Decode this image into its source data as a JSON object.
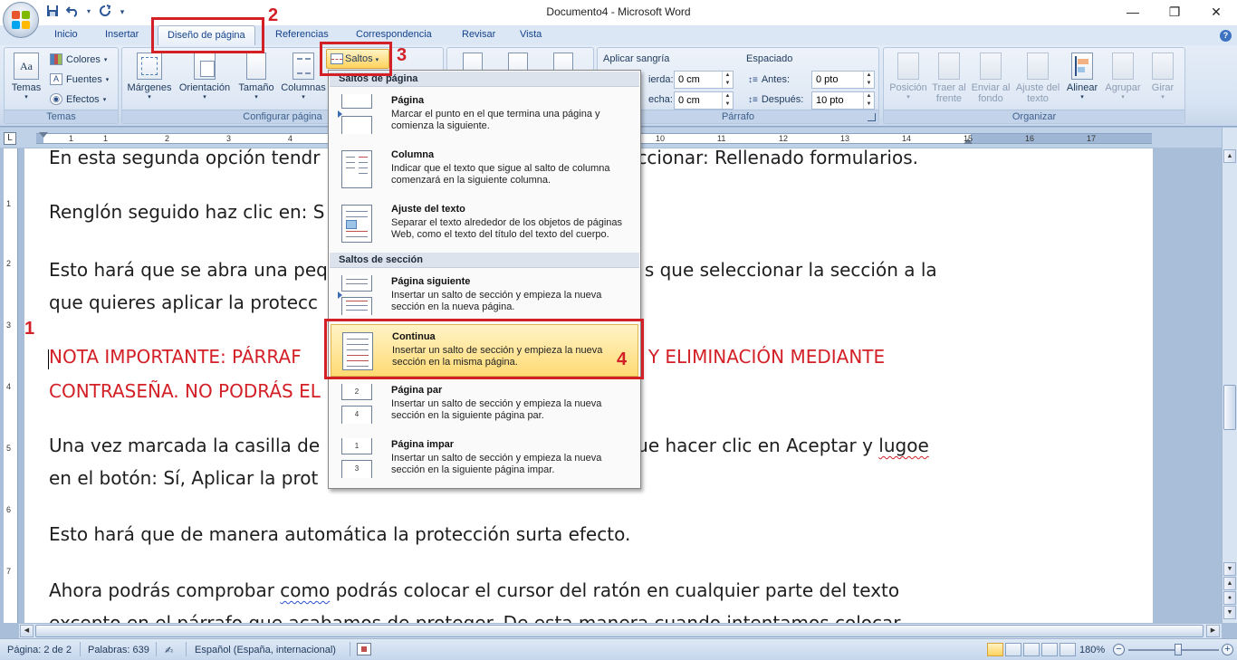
{
  "window": {
    "title": "Documento4 - Microsoft Word",
    "minimize": "—",
    "restore": "❐",
    "close": "✕"
  },
  "qat": {
    "save_icon": "save-icon",
    "undo_icon": "undo-icon",
    "redo_icon": "redo-icon",
    "customize": "▾"
  },
  "tabs": [
    {
      "label": "Inicio"
    },
    {
      "label": "Insertar"
    },
    {
      "label": "Diseño de página",
      "active": true
    },
    {
      "label": "Referencias"
    },
    {
      "label": "Correspondencia"
    },
    {
      "label": "Revisar"
    },
    {
      "label": "Vista"
    }
  ],
  "help": "?",
  "ribbon": {
    "temas": {
      "label": "Temas",
      "temas_btn": "Temas",
      "colores": "Colores",
      "fuentes": "Fuentes",
      "efectos": "Efectos"
    },
    "configurar": {
      "label": "Configurar página",
      "margenes": "Márgenes",
      "orientacion": "Orientación",
      "tamano": "Tamaño",
      "columnas": "Columnas",
      "saltos": "Saltos"
    },
    "parrafo": {
      "label": "Párrafo",
      "sangria_title": "Aplicar sangría",
      "izquierda_label": "ierda:",
      "izquierda_value": "0 cm",
      "derecha_label": "echa:",
      "derecha_value": "0 cm",
      "espaciado_title": "Espaciado",
      "antes_label": "Antes:",
      "antes_value": "0 pto",
      "despues_label": "Después:",
      "despues_value": "10 pto"
    },
    "organizar": {
      "label": "Organizar",
      "posicion": "Posición",
      "traer_l1": "Traer al",
      "traer_l2": "frente",
      "enviar_l1": "Enviar al",
      "enviar_l2": "fondo",
      "ajuste_l1": "Ajuste del",
      "ajuste_l2": "texto",
      "alinear": "Alinear",
      "agrupar": "Agrupar",
      "girar": "Girar"
    }
  },
  "ruler": {
    "ticks": [
      "1",
      "1",
      "2",
      "3",
      "4",
      "10",
      "11",
      "12",
      "13",
      "14",
      "15",
      "16",
      "17"
    ],
    "vticks": [
      "1",
      "2",
      "3",
      "4",
      "5",
      "6",
      "7"
    ]
  },
  "document": {
    "lines": [
      {
        "text": "En esta segunda opción tendr",
        "tail": "ccionar: Rellenado formularios."
      },
      {
        "text": "Renglón seguido haz clic en: S"
      },
      {
        "text": "Esto hará que se abra una peq",
        "tail": "s que seleccionar la sección a la"
      },
      {
        "text": "que quieres aplicar la protecc"
      },
      {
        "text": "NOTA IMPORTANTE: PÁRRAF",
        "tail": "RA Y ELIMINACIÓN MEDIANTE"
      },
      {
        "text": "CONTRASEÑA. NO PODRÁS EL"
      },
      {
        "text": "Una vez marcada la casilla de",
        "tail_a": "ue hacer clic en Aceptar y ",
        "tail_b": "lugoe"
      },
      {
        "text": "en el botón: Sí, Aplicar la prot"
      },
      {
        "text": "Esto hará que de manera automática la protección surta efecto."
      },
      {
        "text_a": "Ahora podrás comprobar ",
        "text_b": "como",
        "text_c": " podrás colocar el cursor del ratón en cualquier parte del texto"
      },
      {
        "text": "excepto en el párrafo que acabamos de proteger. De esta manera cuando intentamos colocar"
      }
    ]
  },
  "menu": {
    "section1": "Saltos de página",
    "section2": "Saltos de sección",
    "items": [
      {
        "title": "Página",
        "desc": "Marcar el punto en el que termina una página y\ncomienza la siguiente."
      },
      {
        "title": "Columna",
        "desc": "Indicar que el texto que sigue al salto de columna\ncomenzará en la siguiente columna."
      },
      {
        "title": "Ajuste del texto",
        "desc": "Separar el texto alrededor de los objetos de páginas\nWeb, como el texto del título del texto del cuerpo."
      },
      {
        "title": "Página siguiente",
        "desc": "Insertar un salto de sección y empieza la nueva\nsección en la nueva página."
      },
      {
        "title": "Continua",
        "desc": "Insertar un salto de sección y empieza la nueva\nsección en la misma página.",
        "highlighted": true
      },
      {
        "title": "Página par",
        "desc": "Insertar un salto de sección y empieza la nueva\nsección en la siguiente página par."
      },
      {
        "title": "Página impar",
        "desc": "Insertar un salto de sección y empieza la nueva\nsección en la siguiente página impar."
      }
    ]
  },
  "annotations": {
    "n1": "1",
    "n2": "2",
    "n3": "3",
    "n4": "4"
  },
  "statusbar": {
    "pagina": "Página: 2 de 2",
    "palabras": "Palabras: 639",
    "idioma": "Español (España, internacional)",
    "zoom": "180%",
    "zoom_minus": "−",
    "zoom_plus": "+"
  },
  "colors": {
    "accent": "#d32027",
    "ribbon": "#dbe7f5",
    "highlight": "#ffdb75"
  }
}
